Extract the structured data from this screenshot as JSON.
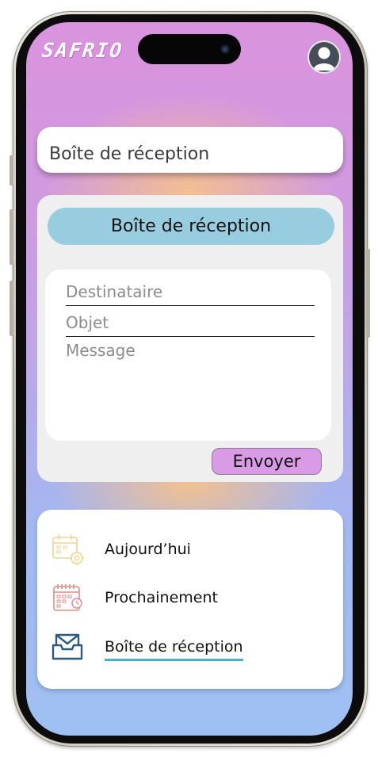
{
  "app": {
    "logo_text": "SAFRIO"
  },
  "header": {
    "page_title": "Boîte de réception"
  },
  "compose": {
    "header_label": "Boîte de réception",
    "recipient_placeholder": "Destinataire",
    "recipient_value": "",
    "subject_placeholder": "Objet",
    "subject_value": "",
    "message_placeholder": "Message",
    "message_value": "",
    "send_label": "Envoyer"
  },
  "nav": {
    "items": [
      {
        "label": "Aujourd’hui",
        "icon": "calendar-gear-icon",
        "active": false
      },
      {
        "label": "Prochainement",
        "icon": "calendar-clock-icon",
        "active": false
      },
      {
        "label": "Boîte de réception",
        "icon": "inbox-icon",
        "active": true
      }
    ]
  },
  "colors": {
    "header_bar": "#98cddf",
    "send_button": "#d99be5",
    "active_underline": "#47b2cd",
    "gradient_top": "#da93de",
    "gradient_bottom": "#9fc0f3"
  }
}
